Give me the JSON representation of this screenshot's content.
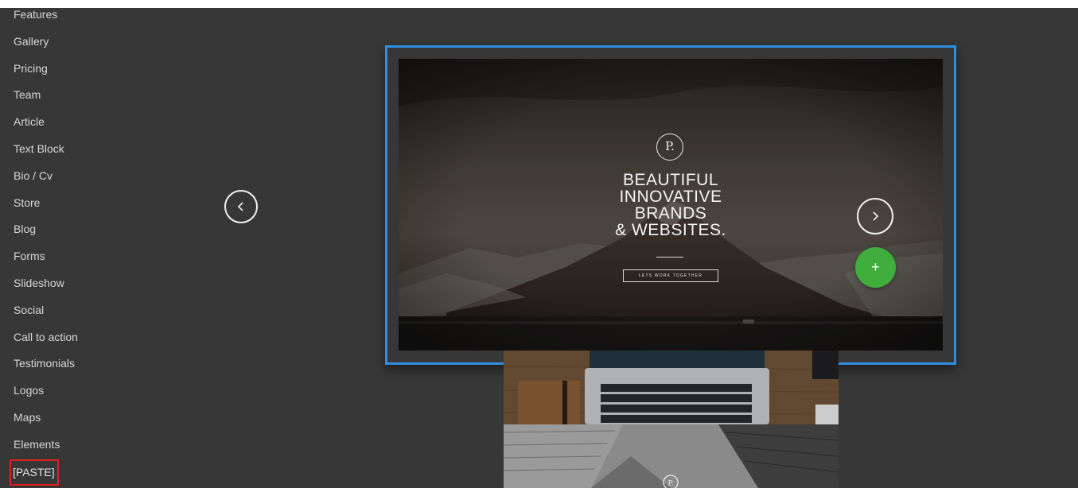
{
  "sidebar": {
    "items": [
      {
        "label": "Features",
        "name": "features"
      },
      {
        "label": "Gallery",
        "name": "gallery"
      },
      {
        "label": "Pricing",
        "name": "pricing"
      },
      {
        "label": "Team",
        "name": "team"
      },
      {
        "label": "Article",
        "name": "article"
      },
      {
        "label": "Text Block",
        "name": "text-block"
      },
      {
        "label": "Bio / Cv",
        "name": "bio-cv"
      },
      {
        "label": "Store",
        "name": "store"
      },
      {
        "label": "Blog",
        "name": "blog"
      },
      {
        "label": "Forms",
        "name": "forms"
      },
      {
        "label": "Slideshow",
        "name": "slideshow"
      },
      {
        "label": "Social",
        "name": "social"
      },
      {
        "label": "Call to action",
        "name": "call-to-action"
      },
      {
        "label": "Testimonials",
        "name": "testimonials"
      },
      {
        "label": "Logos",
        "name": "logos"
      },
      {
        "label": "Maps",
        "name": "maps"
      },
      {
        "label": "Elements",
        "name": "elements"
      }
    ],
    "paste_label": "[PASTE]"
  },
  "preview": {
    "logo_glyph": "P.",
    "title_lines": [
      "BEAUTIFUL",
      "INNOVATIVE",
      "BRANDS",
      "& WEBSITES."
    ],
    "cta_label": "LETS WORK TOGETHER",
    "add_label": "+",
    "thumb_logo_glyph": "P."
  },
  "icons": {
    "prev": "chevron-left-icon",
    "next": "chevron-right-icon",
    "add": "plus-icon"
  },
  "colors": {
    "background": "#373737",
    "selection_border": "#2f8ee0",
    "add_button": "#3fae3d",
    "paste_highlight": "#e02020"
  }
}
